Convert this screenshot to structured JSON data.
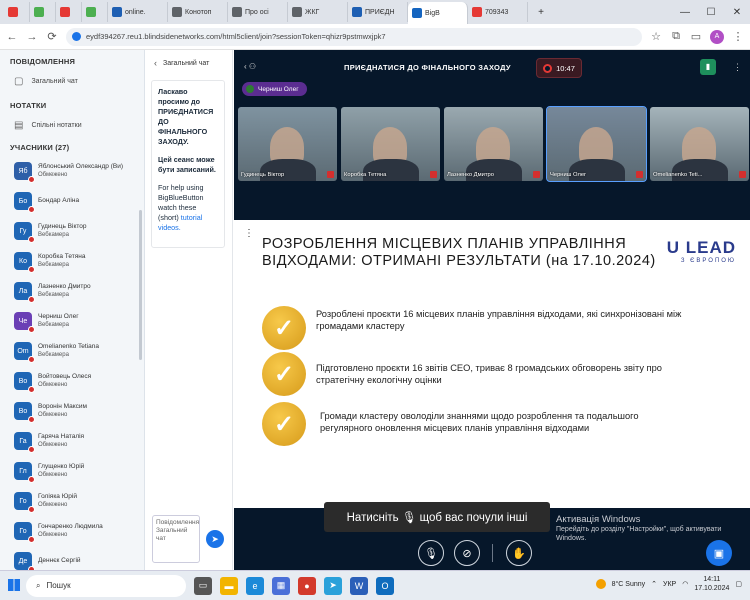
{
  "browser": {
    "tabs": [
      {
        "label": "",
        "color": "#e53935",
        "icon": "youtube-icon"
      },
      {
        "label": "",
        "color": "#4caf50",
        "icon": "image-icon"
      },
      {
        "label": "",
        "color": "#e53935",
        "icon": "youtube-icon"
      },
      {
        "label": "",
        "color": "#4caf50",
        "icon": "image-icon"
      },
      {
        "label": "online.",
        "color": "#1e5fb3",
        "icon": "flag-icon"
      },
      {
        "label": "Конотоп",
        "color": "#5f6368",
        "icon": "globe-icon"
      },
      {
        "label": "Про осі",
        "color": "#5f6368",
        "icon": "globe-icon"
      },
      {
        "label": "ЖКГ",
        "color": "#5f6368",
        "icon": "globe-icon"
      },
      {
        "label": "ПРИЄДН",
        "color": "#1e5fb3",
        "icon": "flag-icon"
      },
      {
        "label": "BigB",
        "color": "#1565c0",
        "icon": "bbb-icon",
        "active": true
      },
      {
        "label": "709343",
        "color": "#e53935",
        "icon": "pdf-icon"
      }
    ],
    "url": "eydf394267.reu1.blindsidenetworks.com/html5client/join?sessionToken=qhizr9pstmwxjpk7",
    "profile_initial": "A"
  },
  "sidebar": {
    "notifications_title": "ПОВІДОМЛЕННЯ",
    "public_chat": "Загальний чат",
    "notes_title": "НОТАТКИ",
    "shared_notes": "Спільні нотатки",
    "users_title": "УЧАСНИКИ (27)",
    "users": [
      {
        "initials": "Яб",
        "name": "Яблонський Олександр (Ви)",
        "status": "Обмежено",
        "color": "#2e5fa8"
      },
      {
        "initials": "Бо",
        "name": "Бондар Аліна",
        "status": "",
        "color": "#1f66b5"
      },
      {
        "initials": "Гу",
        "name": "Гудинець Віктор",
        "status": "Вебкамера",
        "color": "#1f66b5"
      },
      {
        "initials": "Ко",
        "name": "Коробка Тетяна",
        "status": "Вебкамера",
        "color": "#1f66b5"
      },
      {
        "initials": "Ла",
        "name": "Лазненко Дмитро",
        "status": "Вебкамера",
        "color": "#1f66b5"
      },
      {
        "initials": "Че",
        "name": "Черниш Олег",
        "status": "Вебкамера",
        "color": "#6a3fb5"
      },
      {
        "initials": "Om",
        "name": "Omelianenko Tetiana",
        "status": "Вебкамера",
        "color": "#1f66b5"
      },
      {
        "initials": "Во",
        "name": "Войтовець Олеся",
        "status": "Обмежено",
        "color": "#1f66b5"
      },
      {
        "initials": "Во",
        "name": "Воронін Максим",
        "status": "Обмежено",
        "color": "#1f66b5"
      },
      {
        "initials": "Га",
        "name": "Гаряча Наталія",
        "status": "Обмежено",
        "color": "#1f66b5"
      },
      {
        "initials": "Гл",
        "name": "Глущенко Юрій",
        "status": "Обмежено",
        "color": "#1f66b5"
      },
      {
        "initials": "Го",
        "name": "Голіяка Юрій",
        "status": "Обмежено",
        "color": "#1f66b5"
      },
      {
        "initials": "Го",
        "name": "Гончаренко Людмила",
        "status": "Обмежено",
        "color": "#1f66b5"
      },
      {
        "initials": "Де",
        "name": "Деннєк Сергій",
        "status": "",
        "color": "#1f66b5"
      }
    ]
  },
  "chat": {
    "title": "Загальний чат",
    "welcome": "Ласкаво просимо до ПРИЄДНАТИСЯ ДО ФІНАЛЬНОГО ЗАХОДУ.",
    "recording": "Цей сеанс може бути записаний.",
    "help_prefix": "For help using BigBlueButton watch these (short)",
    "help_link": "tutorial videos.",
    "input_placeholder": "Повідомлення Загальний чат"
  },
  "meeting": {
    "title": "ПРИЄДНАТИСЯ ДО ФІНАЛЬНОГО ЗАХОДУ",
    "timer": "10:47",
    "presenter": "Черниш Олег",
    "videos": [
      {
        "name": "Гудинець Віктор",
        "bg": "#7f93a0"
      },
      {
        "name": "Коробка Тетяна",
        "bg": "#8fa0a8"
      },
      {
        "name": "Лазненко Дмитро",
        "bg": "#9aa9b0"
      },
      {
        "name": "Черниш Олег",
        "bg": "#76889a",
        "active": true
      },
      {
        "name": "Omelianenko Teti...",
        "bg": "#a5b4ba"
      }
    ],
    "toast": "Натисніть 🎙 щоб вас почули інші"
  },
  "slide": {
    "title": "РОЗРОБЛЕННЯ МІСЦЕВИХ ПЛАНІВ УПРАВЛІННЯ ВІДХОДАМИ: ОТРИМАНІ РЕЗУЛЬТАТИ (на 17.10.2024)",
    "logo": "U LEAD",
    "logo_sub": "З ЄВРОПОЮ",
    "bullets": [
      "Розроблені проєкти 16 місцевих планів управління відходами, які синхронізовані між громадами кластеру",
      "Підготовлено проєкти 16 звітів СЕО, триває 8 громадських обговорень звіту про стратегічну екологічну оцінки",
      "Громади кластеру оволоділи знаннями щодо розроблення та подальшого регулярного оновлення місцевих планів управління відходами"
    ]
  },
  "watermark": {
    "line1": "Активація Windows",
    "line2": "Перейдіть до розділу \"Настройки\", щоб активувати Windows."
  },
  "taskbar": {
    "search": "Пошук",
    "weather": "8°C Sunny",
    "lang": "УКР",
    "time": "14:11",
    "date": "17.10.2024"
  }
}
